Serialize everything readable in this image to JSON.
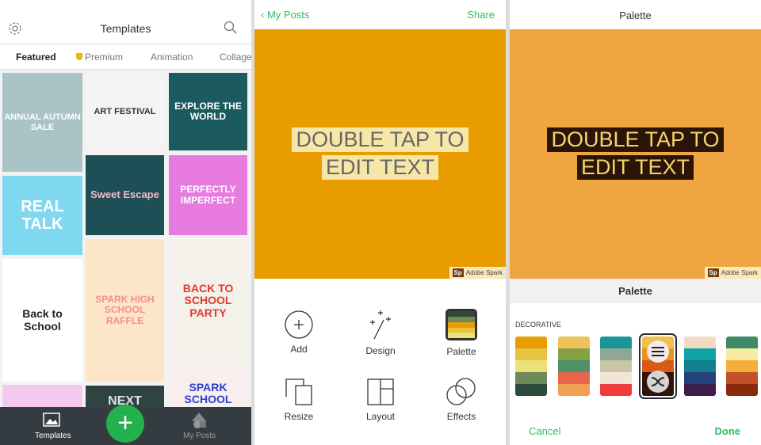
{
  "templates_panel": {
    "title": "Templates",
    "icons": {
      "settings": "gear-icon",
      "search": "search-icon"
    },
    "tabs": [
      {
        "label": "Featured",
        "active": true
      },
      {
        "label": "Premium",
        "badge": "premium-shield-icon"
      },
      {
        "label": "Animation"
      },
      {
        "label": "Collage"
      }
    ],
    "premium_color": "#f2b705",
    "tiles": [
      {
        "text": "ANNUAL AUTUMN SALE",
        "bg": "#a9c3c6",
        "fg": "#ffffff"
      },
      {
        "text": "REAL TALK",
        "bg": "#7fd8f0",
        "fg": "#ffffff"
      },
      {
        "text": "Back to School",
        "bg": "#ffffff",
        "fg": "#222222"
      },
      {
        "text": "",
        "bg": "#f5c8f0",
        "fg": "#ffffff"
      },
      {
        "text": "ART FESTIVAL",
        "bg": "#f4f4f4",
        "fg": "#333333"
      },
      {
        "text": "Sweet Escape",
        "bg": "#1e4f57",
        "fg": "#f7b9c8"
      },
      {
        "text": "SPARK HIGH SCHOOL RAFFLE",
        "bg": "#fde6c8",
        "fg": "#f08f8a"
      },
      {
        "text": "NEXT",
        "bg": "#2f4343",
        "fg": "#d9e6e3"
      },
      {
        "text": "EXPLORE THE WORLD",
        "bg": "#1b5a5e",
        "fg": "#ffffff"
      },
      {
        "text": "PERFECTLY IMPERFECT",
        "bg": "#e77be0",
        "fg": "#ffffff"
      },
      {
        "text": "BACK TO SCHOOL PARTY",
        "bg": "#f4f1ea",
        "fg": "#e03a2f"
      },
      {
        "text": "SPARK SCHOOL",
        "bg": "#f7eeee",
        "fg": "#2b3fd1"
      }
    ],
    "bottom_nav": [
      {
        "label": "Templates",
        "icon": "image-icon",
        "active": true
      },
      {
        "label": "My Posts",
        "icon": "shapes-icon"
      }
    ],
    "fab_icon": "plus-icon"
  },
  "editor_panel": {
    "back_label": "My Posts",
    "share_label": "Share",
    "accent": "#2dbe60",
    "canvas_color": "#e89c00",
    "text_lines": [
      "DOUBLE TAP TO",
      "EDIT TEXT"
    ],
    "watermark": {
      "logo": "Sp",
      "text": "Adobe Spark"
    },
    "tools": [
      {
        "label": "Add",
        "icon": "plus-circle-icon"
      },
      {
        "label": "Design",
        "icon": "magic-wand-icon"
      },
      {
        "label": "Palette",
        "icon": "palette-icon"
      },
      {
        "label": "Resize",
        "icon": "resize-icon"
      },
      {
        "label": "Layout",
        "icon": "layout-icon"
      },
      {
        "label": "Effects",
        "icon": "effects-icon"
      }
    ]
  },
  "palette_panel": {
    "title": "Palette",
    "canvas_color": "#f0a640",
    "text_lines": [
      "DOUBLE TAP TO",
      "EDIT TEXT"
    ],
    "watermark": {
      "logo": "Sp",
      "text": "Adobe Spark"
    },
    "sheet_title": "Palette",
    "section_label": "DECORATIVE",
    "swatches": [
      [
        "#e89c00",
        "#e6c43e",
        "#ece27a",
        "#6f8a5a",
        "#2e4a3c"
      ],
      [
        "#efc35a",
        "#86a046",
        "#4f9168",
        "#e8644a",
        "#f0a050"
      ],
      [
        "#1d9598",
        "#8fa892",
        "#c9c6a6",
        "#f2e4d6",
        "#ef3b3b"
      ],
      [
        "#efc04a",
        "#e8941c",
        "#d9591a",
        "#2e140a",
        "#2e140a"
      ],
      [
        "#f2d9c4",
        "#10a3a3",
        "#137f8c",
        "#24427a",
        "#3d1d4a"
      ],
      [
        "#3f8a68",
        "#f8eca0",
        "#f6ad3c",
        "#c2502a",
        "#8a2a0c"
      ]
    ],
    "selected_swatch": 3,
    "swatch_icons": [
      "sliders-icon",
      "shuffle-icon"
    ],
    "cancel_label": "Cancel",
    "done_label": "Done"
  }
}
